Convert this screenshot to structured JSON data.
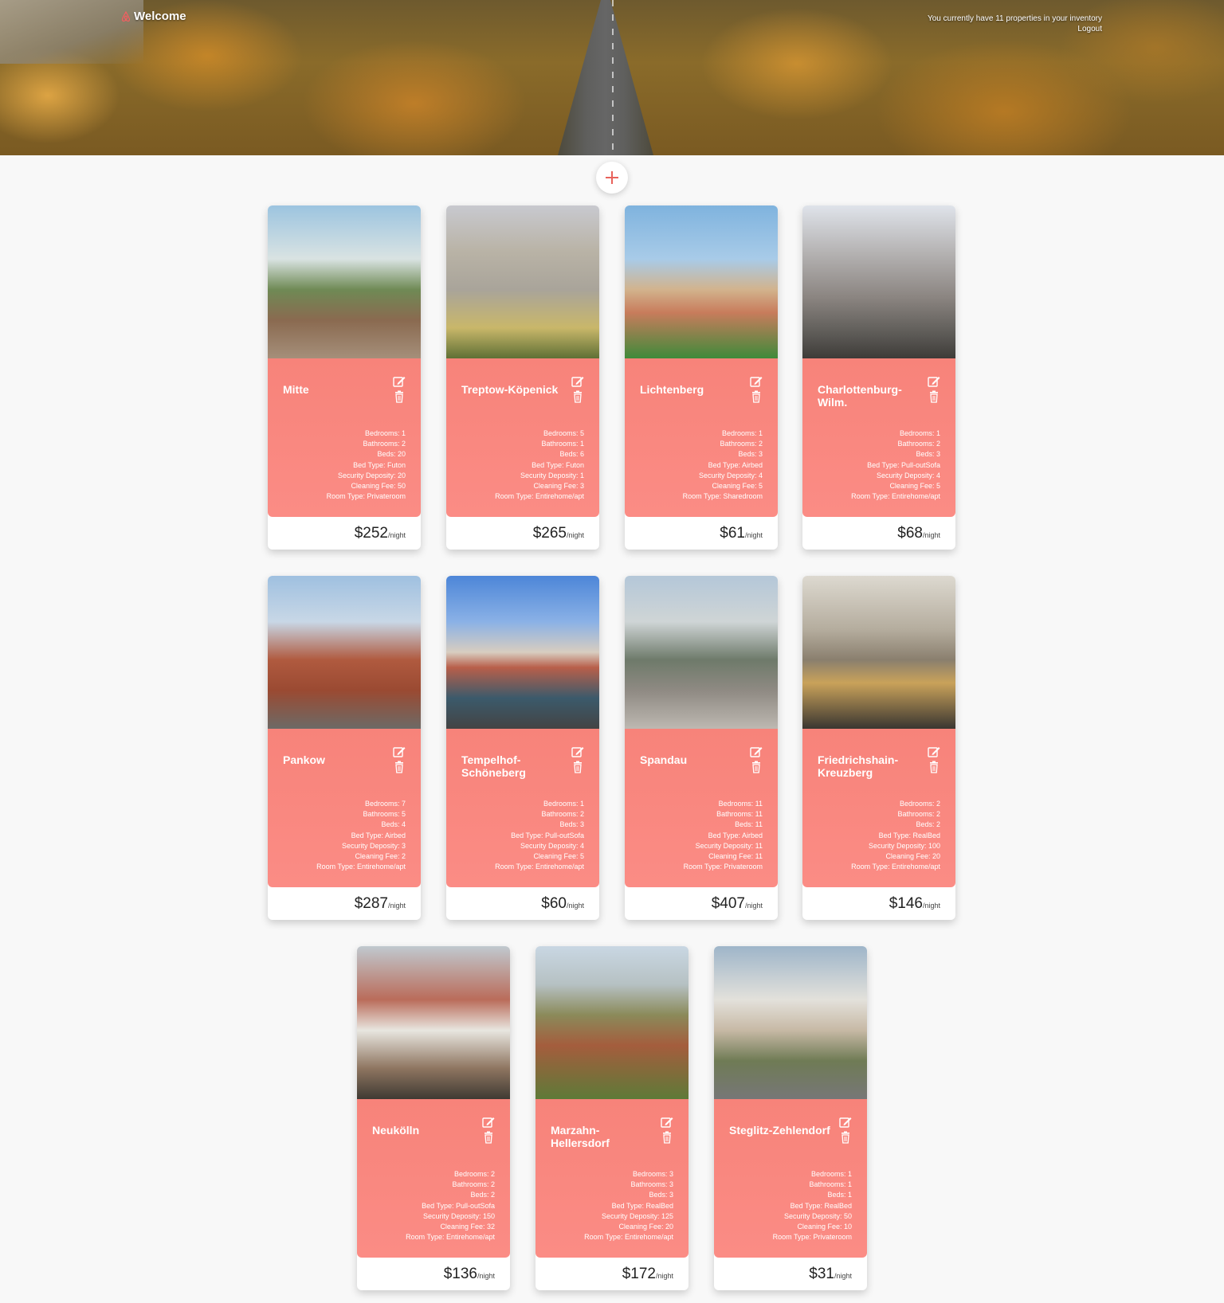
{
  "header": {
    "welcome": "Welcome",
    "inventory_text": "You currently have 11 properties in your inventory",
    "logout": "Logout"
  },
  "colors": {
    "accent": "#f7837a",
    "add_icon": "#e8625b"
  },
  "add_button": {
    "icon": "plus-icon"
  },
  "labels": {
    "bedrooms": "Bedrooms: ",
    "bathrooms": "Bathrooms: ",
    "beds": "Beds: ",
    "bed_type": "Bed Type: ",
    "security_deposit": "Security Deposity: ",
    "cleaning_fee": "Cleaning Fee: ",
    "room_type": "Room Type: ",
    "per_night": "/night"
  },
  "listings": [
    {
      "name": "Mitte",
      "bedrooms": "1",
      "bathrooms": "2",
      "beds": "20",
      "bed_type": "Futon",
      "security_deposit": "20",
      "cleaning_fee": "50",
      "room_type": "Privateroom",
      "price": "$252"
    },
    {
      "name": "Treptow-Köpenick",
      "bedrooms": "5",
      "bathrooms": "1",
      "beds": "6",
      "bed_type": "Futon",
      "security_deposit": "1",
      "cleaning_fee": "3",
      "room_type": "Entirehome/apt",
      "price": "$265"
    },
    {
      "name": "Lichtenberg",
      "bedrooms": "1",
      "bathrooms": "2",
      "beds": "3",
      "bed_type": "Airbed",
      "security_deposit": "4",
      "cleaning_fee": "5",
      "room_type": "Sharedroom",
      "price": "$61"
    },
    {
      "name": "Charlottenburg-Wilm.",
      "bedrooms": "1",
      "bathrooms": "2",
      "beds": "3",
      "bed_type": "Pull-outSofa",
      "security_deposit": "4",
      "cleaning_fee": "5",
      "room_type": "Entirehome/apt",
      "price": "$68"
    },
    {
      "name": "Pankow",
      "bedrooms": "7",
      "bathrooms": "5",
      "beds": "4",
      "bed_type": "Airbed",
      "security_deposit": "3",
      "cleaning_fee": "2",
      "room_type": "Entirehome/apt",
      "price": "$287"
    },
    {
      "name": "Tempelhof-Schöneberg",
      "bedrooms": "1",
      "bathrooms": "2",
      "beds": "3",
      "bed_type": "Pull-outSofa",
      "security_deposit": "4",
      "cleaning_fee": "5",
      "room_type": "Entirehome/apt",
      "price": "$60"
    },
    {
      "name": "Spandau",
      "bedrooms": "11",
      "bathrooms": "11",
      "beds": "11",
      "bed_type": "Airbed",
      "security_deposit": "11",
      "cleaning_fee": "11",
      "room_type": "Privateroom",
      "price": "$407"
    },
    {
      "name": "Friedrichshain-Kreuzberg",
      "bedrooms": "2",
      "bathrooms": "2",
      "beds": "2",
      "bed_type": "RealBed",
      "security_deposit": "100",
      "cleaning_fee": "20",
      "room_type": "Entirehome/apt",
      "price": "$146"
    },
    {
      "name": "Neukölln",
      "bedrooms": "2",
      "bathrooms": "2",
      "beds": "2",
      "bed_type": "Pull-outSofa",
      "security_deposit": "150",
      "cleaning_fee": "32",
      "room_type": "Entirehome/apt",
      "price": "$136"
    },
    {
      "name": "Marzahn-Hellersdorf",
      "bedrooms": "3",
      "bathrooms": "3",
      "beds": "3",
      "bed_type": "RealBed",
      "security_deposit": "125",
      "cleaning_fee": "20",
      "room_type": "Entirehome/apt",
      "price": "$172"
    },
    {
      "name": "Steglitz-Zehlendorf",
      "bedrooms": "1",
      "bathrooms": "1",
      "beds": "1",
      "bed_type": "RealBed",
      "security_deposit": "50",
      "cleaning_fee": "10",
      "room_type": "Privateroom",
      "price": "$31"
    }
  ]
}
